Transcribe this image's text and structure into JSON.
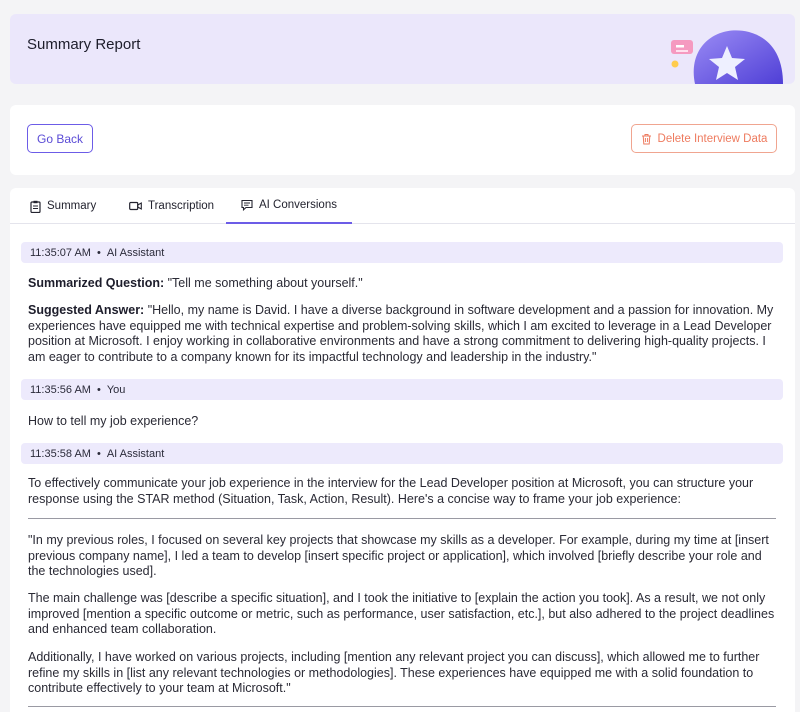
{
  "header": {
    "title": "Summary Report"
  },
  "toolbar": {
    "back_label": "Go Back",
    "delete_label": "Delete Interview Data"
  },
  "tabs": [
    {
      "label": "Summary",
      "icon": "clipboard-icon"
    },
    {
      "label": "Transcription",
      "icon": "video-icon"
    },
    {
      "label": "AI Conversions",
      "icon": "chat-icon",
      "active": true
    }
  ],
  "messages": {
    "m1": {
      "time": "11:35:07 AM",
      "sender": "AI Assistant",
      "question_label": "Summarized Question:",
      "question": " \"Tell me something about yourself.\"",
      "answer_label": "Suggested Answer:",
      "answer": " \"Hello, my name is David. I have a diverse background in software development and a passion for innovation. My experiences have equipped me with technical expertise and problem-solving skills, which I am excited to leverage in a Lead Developer position at Microsoft. I enjoy working in collaborative environments and have a strong commitment to delivering high-quality projects. I am eager to contribute to a company known for its impactful technology and leadership in the industry.\""
    },
    "m2": {
      "time": "11:35:56 AM",
      "sender": "You",
      "text": "How to tell my job experience?"
    },
    "m3": {
      "time": "11:35:58 AM",
      "sender": "AI Assistant",
      "intro": "To effectively communicate your job experience in the interview for the Lead Developer position at Microsoft, you can structure your response using the STAR method (Situation, Task, Action, Result). Here's a concise way to frame your job experience:",
      "p1": "\"In my previous roles, I focused on several key projects that showcase my skills as a developer. For example, during my time at [insert previous company name], I led a team to develop [insert specific project or application], which involved [briefly describe your role and the technologies used].",
      "p2": "The main challenge was [describe a specific situation], and I took the initiative to [explain the action you took]. As a result, we not only improved [mention a specific outcome or metric, such as performance, user satisfaction, etc.], but also adhered to the project deadlines and enhanced team collaboration.",
      "p3": "Additionally, I have worked on various projects, including [mention any relevant project you can discuss], which allowed me to further refine my skills in [list any relevant technologies or methodologies]. These experiences have equipped me with a solid foundation to contribute effectively to your team at Microsoft.\""
    }
  },
  "separator": "•",
  "colors": {
    "accent": "#6c5ce7",
    "danger": "#ee7b5f",
    "header_bg": "#ebe7fb",
    "msg_head_bg": "#edeafc"
  }
}
